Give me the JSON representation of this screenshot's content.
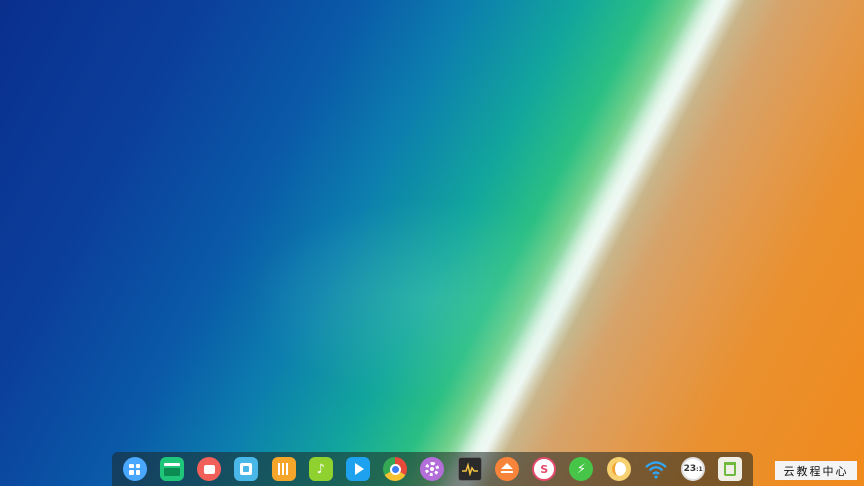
{
  "desktop": {
    "wallpaper": "aerial ocean wave beach"
  },
  "dock": {
    "items": [
      {
        "name": "launcher",
        "icon": "launcher-grid-icon"
      },
      {
        "name": "show-desktop",
        "icon": "window-icon"
      },
      {
        "name": "multitasking-view",
        "icon": "multitask-icon"
      },
      {
        "name": "app-store",
        "icon": "store-bag-icon"
      },
      {
        "name": "file-manager",
        "icon": "folder-icon"
      },
      {
        "name": "music",
        "icon": "music-note-icon"
      },
      {
        "name": "movie",
        "icon": "play-icon"
      },
      {
        "name": "chrome",
        "icon": "chrome-icon"
      },
      {
        "name": "control-center",
        "icon": "gear-icon"
      },
      {
        "name": "system-monitor",
        "icon": "monitor-icon"
      },
      {
        "name": "disk-eject",
        "icon": "eject-icon"
      },
      {
        "name": "screenshot",
        "icon": "screenshot-icon",
        "label": "S"
      },
      {
        "name": "power",
        "icon": "power-icon"
      },
      {
        "name": "cleaner",
        "icon": "cleaner-icon"
      },
      {
        "name": "network",
        "icon": "wifi-icon"
      },
      {
        "name": "clock",
        "icon": "clock-icon",
        "time": "23",
        "suffix": ":1"
      },
      {
        "name": "trash",
        "icon": "trash-icon"
      }
    ]
  },
  "watermark": {
    "text": "云教程中心"
  },
  "colors": {
    "ocean_deep": "#0a2f8e",
    "surf": "#e8f6f0",
    "sand": "#f08a1c",
    "dock_bg": "rgba(30,38,36,0.55)"
  }
}
